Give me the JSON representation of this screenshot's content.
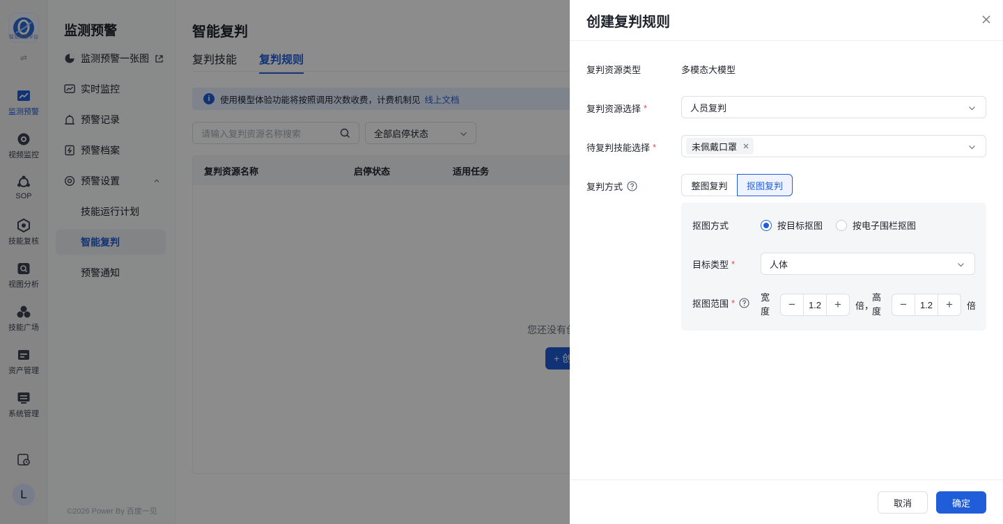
{
  "rail": {
    "logo_text": "智览预警平台",
    "items": [
      {
        "label": "监测预警",
        "icon": "chart-line-icon",
        "active": true
      },
      {
        "label": "视频监控",
        "icon": "camera-icon"
      },
      {
        "label": "SOP",
        "icon": "sop-icon"
      },
      {
        "label": "技能复核",
        "icon": "hexagon-check-icon"
      },
      {
        "label": "视图分析",
        "icon": "image-search-icon"
      },
      {
        "label": "技能广场",
        "icon": "cluster-icon"
      },
      {
        "label": "资产管理",
        "icon": "asset-icon"
      },
      {
        "label": "系统管理",
        "icon": "system-icon"
      }
    ],
    "avatar": "L"
  },
  "sidebar": {
    "title": "监测预警",
    "items": [
      {
        "label": "监测预警一张图",
        "icon": "pie-chart-icon"
      },
      {
        "label": "实时监控",
        "icon": "monitor-chart-icon"
      },
      {
        "label": "预警记录",
        "icon": "alarm-record-icon"
      },
      {
        "label": "预警档案",
        "icon": "archive-icon"
      },
      {
        "label": "预警设置",
        "icon": "settings-icon"
      }
    ],
    "sub_items": [
      {
        "label": "技能运行计划"
      },
      {
        "label": "智能复判",
        "selected": true
      },
      {
        "label": "预警通知"
      }
    ],
    "footer": "©2026 Power By 百度一见"
  },
  "main": {
    "title": "智能复判",
    "tabs": [
      {
        "label": "复判技能"
      },
      {
        "label": "复判规则",
        "active": true
      }
    ],
    "notice": "使用模型体验功能将按照调用次数收费，计费机制见",
    "notice_link": "线上文档",
    "search_placeholder": "请输入复判资源名称搜索",
    "status_filter": "全部启停状态",
    "columns": [
      "复判资源名称",
      "启停状态",
      "适用任务"
    ],
    "empty_text": "您还没有创",
    "empty_button": "+ 创"
  },
  "drawer": {
    "title": "创建复判规则",
    "fields": {
      "resource_type": {
        "label": "复判资源类型",
        "value": "多模态大模型"
      },
      "resource_select": {
        "label": "复判资源选择",
        "value": "人员复判"
      },
      "skill_select": {
        "label": "待复判技能选择",
        "tag": "未佩戴口罩"
      },
      "method": {
        "label": "复判方式",
        "options": [
          "整图复判",
          "抠图复判"
        ],
        "selected": "抠图复判"
      }
    },
    "crop": {
      "mode_label": "抠图方式",
      "modes": [
        "按目标抠图",
        "按电子围栏抠图"
      ],
      "mode_selected": "按目标抠图",
      "target_label": "目标类型",
      "target_value": "人体",
      "range_label": "抠图范围",
      "width_label": "宽度",
      "height_label": "高度",
      "width_value": "1.2",
      "height_value": "1.2",
      "unit_width": "倍，",
      "unit_height": "倍"
    },
    "cancel": "取消",
    "confirm": "确定"
  },
  "colors": {
    "accent": "#1f5ed8",
    "required": "#e5484d"
  }
}
